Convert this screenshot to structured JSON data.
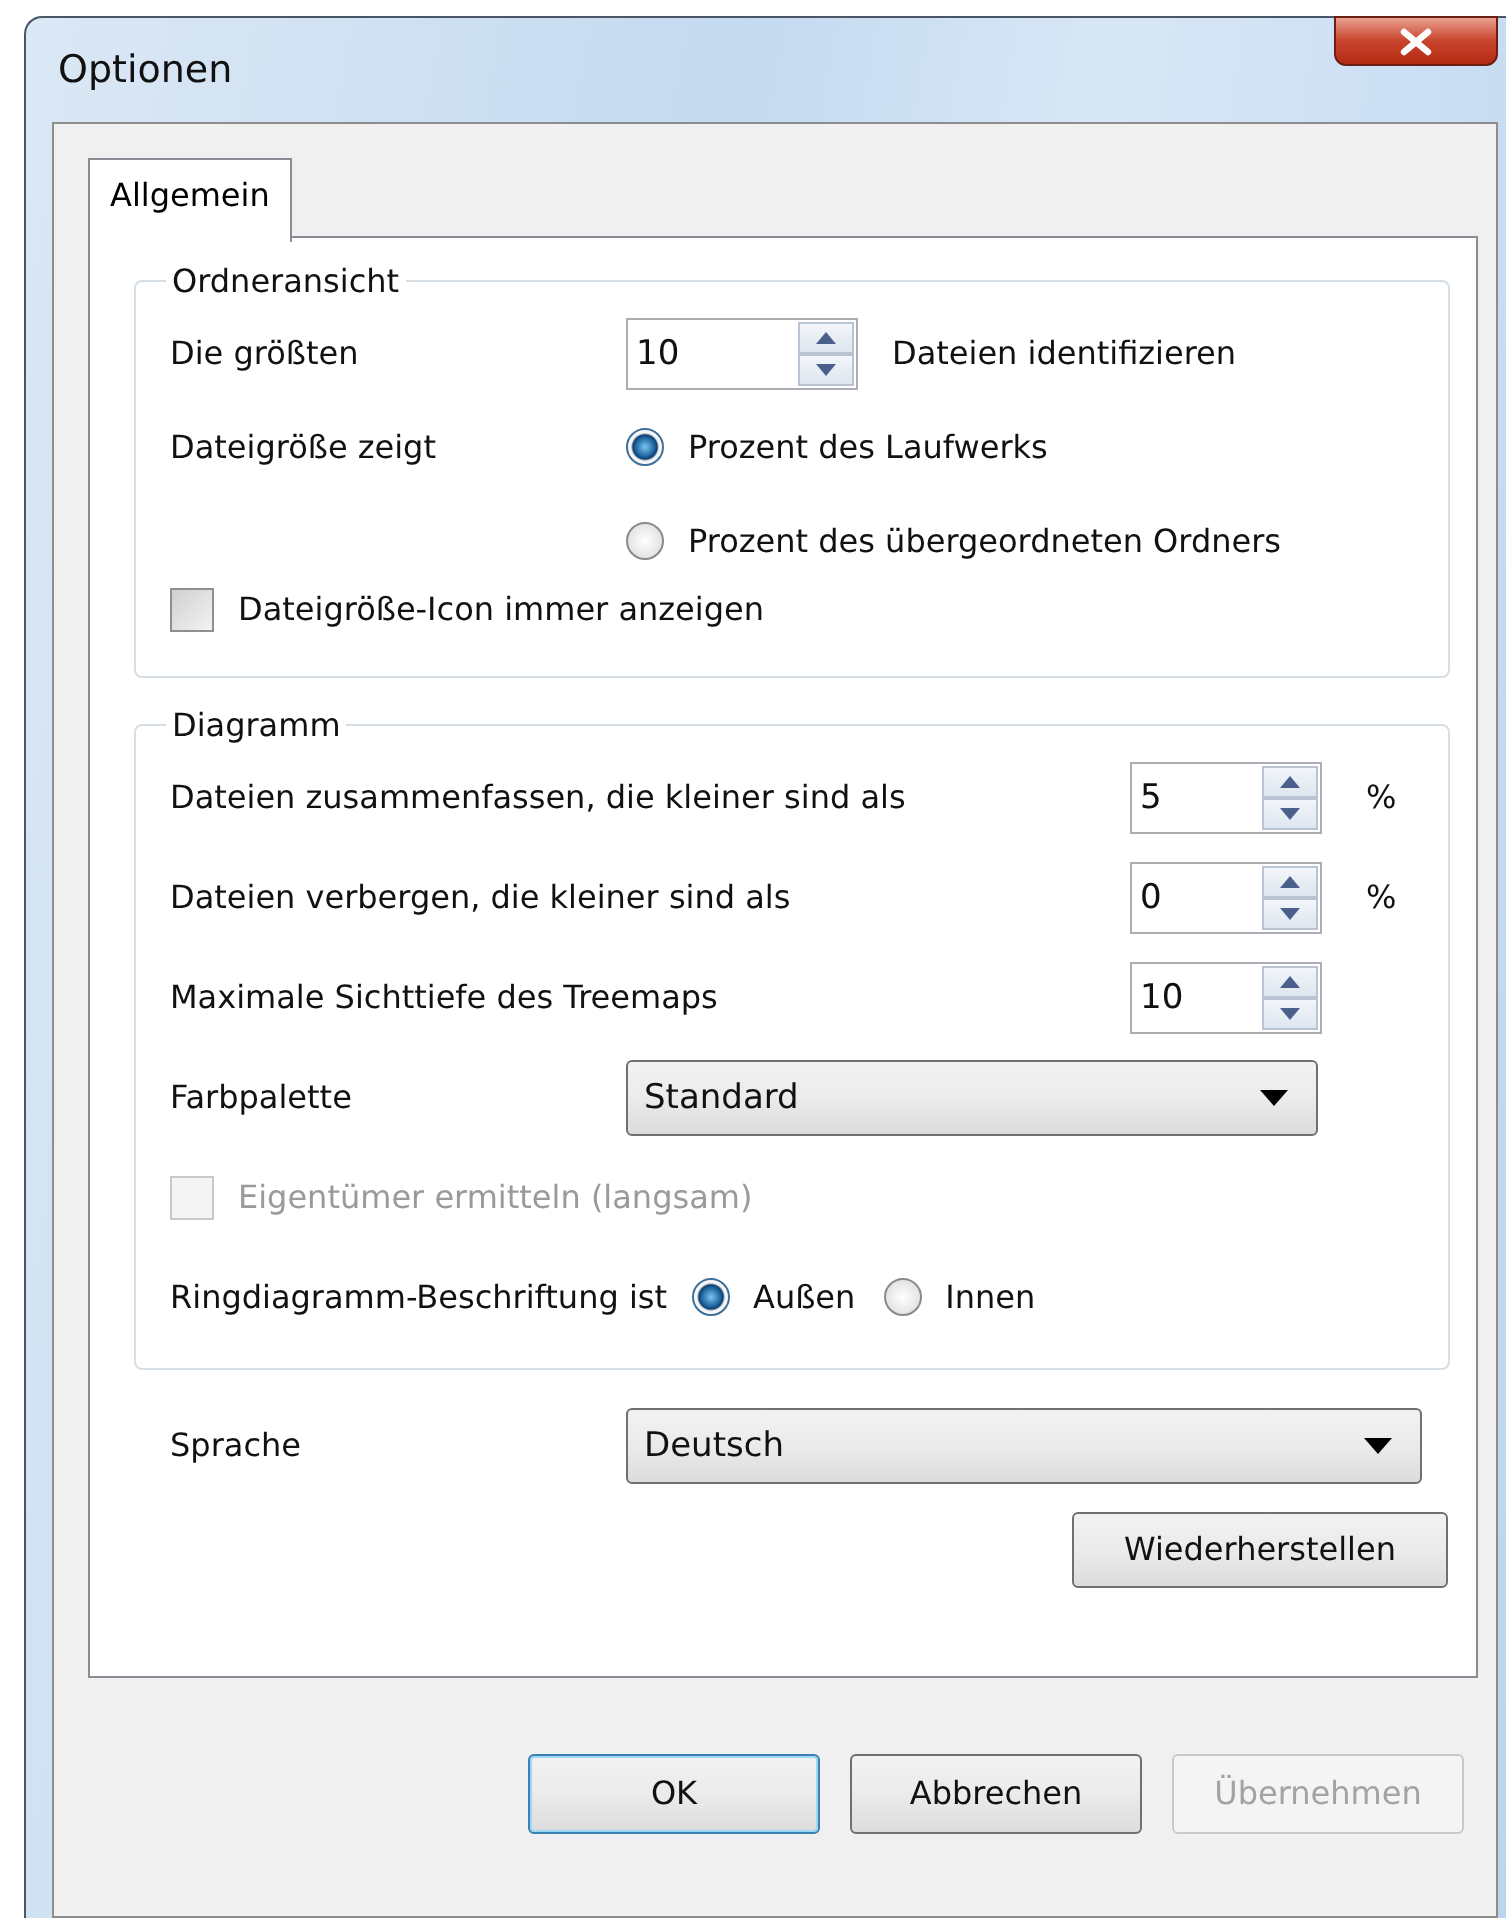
{
  "window": {
    "title": "Optionen"
  },
  "tabs": [
    {
      "label": "Allgemein",
      "selected": true
    }
  ],
  "groups": [
    {
      "title": "Ordneransicht",
      "rows": [
        {
          "kind": "spin",
          "label": "Die größten",
          "value": "10",
          "suffix": "Dateien identifizieren"
        },
        {
          "kind": "radio-stack",
          "label": "Dateigröße zeigt",
          "options": [
            {
              "label": "Prozent des Laufwerks",
              "selected": true
            },
            {
              "label": "Prozent des übergeordneten Ordners",
              "selected": false
            }
          ]
        },
        {
          "kind": "check",
          "label": "Dateigröße-Icon immer anzeigen",
          "checked": false,
          "disabled": false
        }
      ]
    },
    {
      "title": "Diagramm",
      "rows": [
        {
          "kind": "spin",
          "label": "Dateien zusammenfassen, die kleiner sind als",
          "value": "5",
          "suffix": "%"
        },
        {
          "kind": "spin",
          "label": "Dateien verbergen, die kleiner sind als",
          "value": "0",
          "suffix": "%"
        },
        {
          "kind": "spin",
          "label": "Maximale Sichttiefe des Treemaps",
          "value": "10"
        },
        {
          "kind": "select",
          "label": "Farbpalette",
          "value": "Standard"
        },
        {
          "kind": "check",
          "label": "Eigentümer ermitteln (langsam)",
          "checked": false,
          "disabled": true
        },
        {
          "kind": "radio-inline",
          "label": "Ringdiagramm-Beschriftung ist",
          "options": [
            {
              "label": "Außen",
              "selected": true
            },
            {
              "label": "Innen",
              "selected": false
            }
          ]
        }
      ]
    }
  ],
  "language": {
    "label": "Sprache",
    "value": "Deutsch"
  },
  "reset_button": {
    "label": "Wiederherstellen"
  },
  "buttons": [
    {
      "label": "OK",
      "default": true,
      "disabled": false
    },
    {
      "label": "Abbrechen",
      "default": false,
      "disabled": false
    },
    {
      "label": "Übernehmen",
      "default": false,
      "disabled": true
    }
  ]
}
